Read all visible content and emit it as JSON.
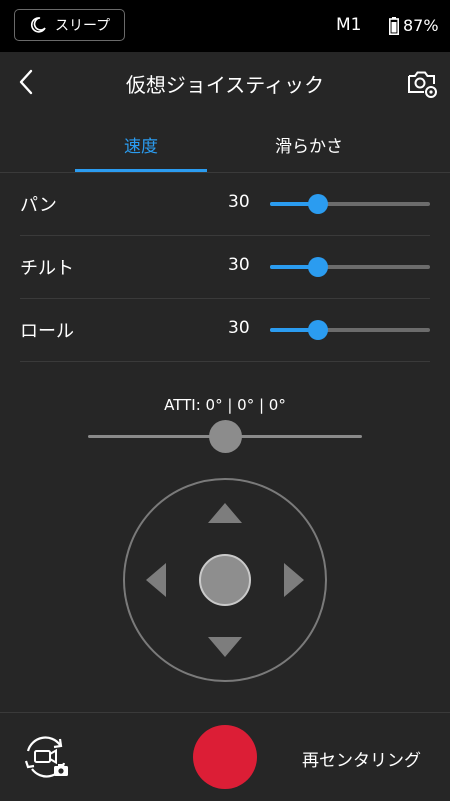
{
  "status_bar": {
    "sleep_label": "スリープ",
    "mode": "M1",
    "battery": "87%"
  },
  "header": {
    "title": "仮想ジョイスティック"
  },
  "tabs": [
    {
      "label": "速度",
      "active": true
    },
    {
      "label": "滑らかさ",
      "active": false
    }
  ],
  "axes": [
    {
      "label": "パン",
      "value": "30",
      "level": 0.3
    },
    {
      "label": "チルト",
      "value": "30",
      "level": 0.3
    },
    {
      "label": "ロール",
      "value": "30",
      "level": 0.3
    }
  ],
  "atti": {
    "label": "ATTI: 0° | 0° | 0°",
    "level": 0.5
  },
  "bottom": {
    "recenter_label": "再センタリング"
  },
  "colors": {
    "accent": "#2b9cf0",
    "record": "#dc1e36",
    "background": "#262626"
  }
}
